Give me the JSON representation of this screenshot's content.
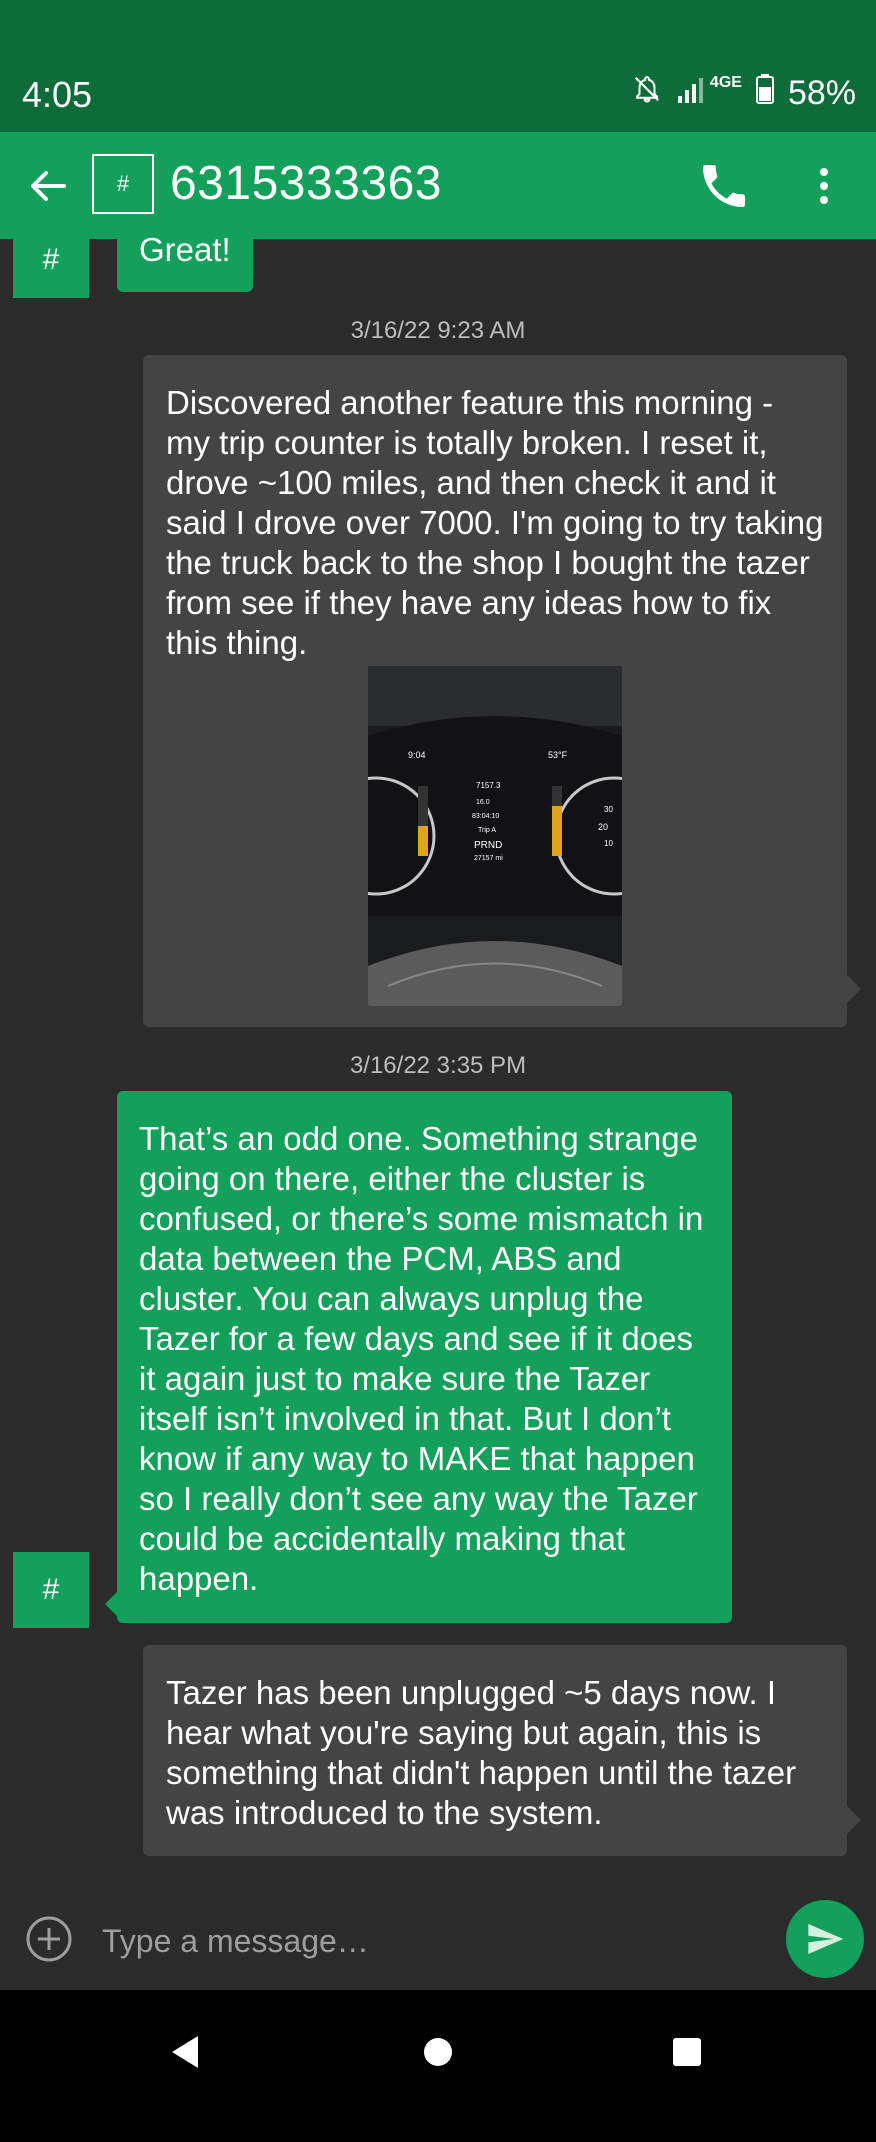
{
  "status_bar": {
    "time": "4:05",
    "network": "4GE",
    "battery": "58%"
  },
  "header": {
    "avatar_symbol": "#",
    "contact": "6315333363"
  },
  "messages": [
    {
      "direction": "outgoing",
      "avatar_symbol": "#",
      "text": "Great!"
    },
    {
      "direction": "timestamp",
      "text": "3/16/22 9:23 AM"
    },
    {
      "direction": "incoming",
      "text": "Discovered another feature this morning - my trip counter is totally broken. I reset it, drove ~100 miles, and then check it and it said I drove over 7000. I'm going to try taking the truck back to the shop I bought the tazer from see if they have any ideas how to fix this thing.",
      "image": {
        "clock": "9:04",
        "temp": "53°F",
        "trip_distance": "7157.3",
        "mpg": "16.0",
        "elapsed": "83:04:10",
        "trip_label": "Trip A",
        "gear": "PRND",
        "odometer": "27157 mi",
        "gauge_20": "20",
        "gauge_30": "30",
        "gauge_10": "10"
      }
    },
    {
      "direction": "timestamp",
      "text": "3/16/22 3:35 PM"
    },
    {
      "direction": "outgoing",
      "avatar_symbol": "#",
      "text": "That’s an odd one. Something strange going on there, either the cluster is confused, or there’s some mismatch in data between the PCM, ABS and cluster.  You can always unplug the Tazer for a few days and see if it does it again just to make sure the Tazer itself isn’t involved in that. But I don’t know if any way to MAKE that happen so I really don’t see any way the Tazer could be accidentally making that happen."
    },
    {
      "direction": "incoming",
      "text": "Tazer has been unplugged ~5 days now. I hear what you're saying but again, this is something that didn't happen until the tazer was introduced to the system."
    }
  ],
  "composer": {
    "placeholder": "Type a message…"
  },
  "colors": {
    "status_bar": "#0e6b3a",
    "app_bar": "#12a05a",
    "outgoing_bubble": "#12a05a",
    "incoming_bubble": "#444444",
    "background": "#2b2b2b"
  },
  "icons": [
    "back-arrow-icon",
    "phone-icon",
    "more-vert-icon",
    "add-circle-icon",
    "send-icon",
    "mute-icon",
    "signal-icon",
    "battery-icon"
  ]
}
